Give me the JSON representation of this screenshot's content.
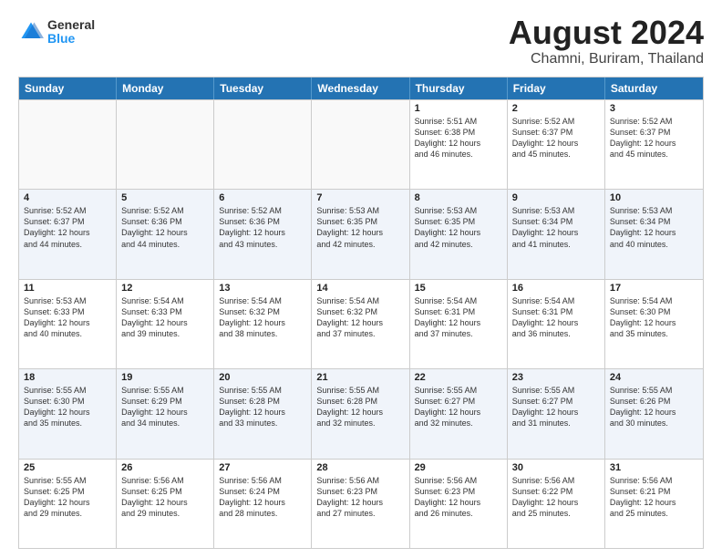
{
  "logo": {
    "general": "General",
    "blue": "Blue"
  },
  "title": "August 2024",
  "subtitle": "Chamni, Buriram, Thailand",
  "header_days": [
    "Sunday",
    "Monday",
    "Tuesday",
    "Wednesday",
    "Thursday",
    "Friday",
    "Saturday"
  ],
  "rows": [
    [
      {
        "day": "",
        "info": "",
        "empty": true
      },
      {
        "day": "",
        "info": "",
        "empty": true
      },
      {
        "day": "",
        "info": "",
        "empty": true
      },
      {
        "day": "",
        "info": "",
        "empty": true
      },
      {
        "day": "1",
        "info": "Sunrise: 5:51 AM\nSunset: 6:38 PM\nDaylight: 12 hours\nand 46 minutes."
      },
      {
        "day": "2",
        "info": "Sunrise: 5:52 AM\nSunset: 6:37 PM\nDaylight: 12 hours\nand 45 minutes."
      },
      {
        "day": "3",
        "info": "Sunrise: 5:52 AM\nSunset: 6:37 PM\nDaylight: 12 hours\nand 45 minutes."
      }
    ],
    [
      {
        "day": "4",
        "info": "Sunrise: 5:52 AM\nSunset: 6:37 PM\nDaylight: 12 hours\nand 44 minutes."
      },
      {
        "day": "5",
        "info": "Sunrise: 5:52 AM\nSunset: 6:36 PM\nDaylight: 12 hours\nand 44 minutes."
      },
      {
        "day": "6",
        "info": "Sunrise: 5:52 AM\nSunset: 6:36 PM\nDaylight: 12 hours\nand 43 minutes."
      },
      {
        "day": "7",
        "info": "Sunrise: 5:53 AM\nSunset: 6:35 PM\nDaylight: 12 hours\nand 42 minutes."
      },
      {
        "day": "8",
        "info": "Sunrise: 5:53 AM\nSunset: 6:35 PM\nDaylight: 12 hours\nand 42 minutes."
      },
      {
        "day": "9",
        "info": "Sunrise: 5:53 AM\nSunset: 6:34 PM\nDaylight: 12 hours\nand 41 minutes."
      },
      {
        "day": "10",
        "info": "Sunrise: 5:53 AM\nSunset: 6:34 PM\nDaylight: 12 hours\nand 40 minutes."
      }
    ],
    [
      {
        "day": "11",
        "info": "Sunrise: 5:53 AM\nSunset: 6:33 PM\nDaylight: 12 hours\nand 40 minutes."
      },
      {
        "day": "12",
        "info": "Sunrise: 5:54 AM\nSunset: 6:33 PM\nDaylight: 12 hours\nand 39 minutes."
      },
      {
        "day": "13",
        "info": "Sunrise: 5:54 AM\nSunset: 6:32 PM\nDaylight: 12 hours\nand 38 minutes."
      },
      {
        "day": "14",
        "info": "Sunrise: 5:54 AM\nSunset: 6:32 PM\nDaylight: 12 hours\nand 37 minutes."
      },
      {
        "day": "15",
        "info": "Sunrise: 5:54 AM\nSunset: 6:31 PM\nDaylight: 12 hours\nand 37 minutes."
      },
      {
        "day": "16",
        "info": "Sunrise: 5:54 AM\nSunset: 6:31 PM\nDaylight: 12 hours\nand 36 minutes."
      },
      {
        "day": "17",
        "info": "Sunrise: 5:54 AM\nSunset: 6:30 PM\nDaylight: 12 hours\nand 35 minutes."
      }
    ],
    [
      {
        "day": "18",
        "info": "Sunrise: 5:55 AM\nSunset: 6:30 PM\nDaylight: 12 hours\nand 35 minutes."
      },
      {
        "day": "19",
        "info": "Sunrise: 5:55 AM\nSunset: 6:29 PM\nDaylight: 12 hours\nand 34 minutes."
      },
      {
        "day": "20",
        "info": "Sunrise: 5:55 AM\nSunset: 6:28 PM\nDaylight: 12 hours\nand 33 minutes."
      },
      {
        "day": "21",
        "info": "Sunrise: 5:55 AM\nSunset: 6:28 PM\nDaylight: 12 hours\nand 32 minutes."
      },
      {
        "day": "22",
        "info": "Sunrise: 5:55 AM\nSunset: 6:27 PM\nDaylight: 12 hours\nand 32 minutes."
      },
      {
        "day": "23",
        "info": "Sunrise: 5:55 AM\nSunset: 6:27 PM\nDaylight: 12 hours\nand 31 minutes."
      },
      {
        "day": "24",
        "info": "Sunrise: 5:55 AM\nSunset: 6:26 PM\nDaylight: 12 hours\nand 30 minutes."
      }
    ],
    [
      {
        "day": "25",
        "info": "Sunrise: 5:55 AM\nSunset: 6:25 PM\nDaylight: 12 hours\nand 29 minutes."
      },
      {
        "day": "26",
        "info": "Sunrise: 5:56 AM\nSunset: 6:25 PM\nDaylight: 12 hours\nand 29 minutes."
      },
      {
        "day": "27",
        "info": "Sunrise: 5:56 AM\nSunset: 6:24 PM\nDaylight: 12 hours\nand 28 minutes."
      },
      {
        "day": "28",
        "info": "Sunrise: 5:56 AM\nSunset: 6:23 PM\nDaylight: 12 hours\nand 27 minutes."
      },
      {
        "day": "29",
        "info": "Sunrise: 5:56 AM\nSunset: 6:23 PM\nDaylight: 12 hours\nand 26 minutes."
      },
      {
        "day": "30",
        "info": "Sunrise: 5:56 AM\nSunset: 6:22 PM\nDaylight: 12 hours\nand 25 minutes."
      },
      {
        "day": "31",
        "info": "Sunrise: 5:56 AM\nSunset: 6:21 PM\nDaylight: 12 hours\nand 25 minutes."
      }
    ]
  ]
}
